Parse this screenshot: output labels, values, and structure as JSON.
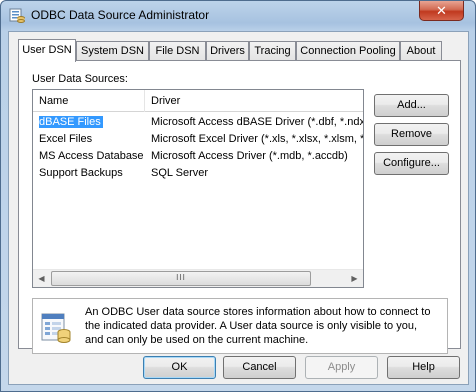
{
  "window": {
    "title": "ODBC Data Source Administrator",
    "close_glyph": "✕"
  },
  "tabs": [
    {
      "label": "User DSN",
      "active": true
    },
    {
      "label": "System DSN"
    },
    {
      "label": "File DSN"
    },
    {
      "label": "Drivers"
    },
    {
      "label": "Tracing"
    },
    {
      "label": "Connection Pooling"
    },
    {
      "label": "About"
    }
  ],
  "user_dsn": {
    "section_label": "User Data Sources:",
    "columns": [
      "Name",
      "Driver"
    ],
    "rows": [
      {
        "name": "dBASE Files",
        "driver": "Microsoft Access dBASE Driver (*.dbf, *.ndx",
        "selected": true
      },
      {
        "name": "Excel Files",
        "driver": "Microsoft Excel Driver (*.xls, *.xlsx, *.xlsm, *.x"
      },
      {
        "name": "MS Access Database",
        "driver": "Microsoft Access Driver (*.mdb, *.accdb)"
      },
      {
        "name": "Support Backups",
        "driver": "SQL Server"
      }
    ],
    "scroll": {
      "left_glyph": "◀",
      "right_glyph": "▶",
      "grip": "III"
    },
    "buttons": {
      "add": "Add...",
      "remove": "Remove",
      "configure": "Configure..."
    },
    "info_lines": [
      "An ODBC User data source stores information about how to connect to",
      "the indicated data provider.   A User data source is only visible to you,",
      "and can only be used on the current machine."
    ]
  },
  "footer": {
    "ok": "OK",
    "cancel": "Cancel",
    "apply": "Apply",
    "help": "Help"
  },
  "icons": {
    "app": "odbc-admin-icon",
    "info": "data-source-icon"
  },
  "colors": {
    "selection": "#3399ff",
    "close": "#c0391f",
    "default_button": "#3c7fb1"
  }
}
